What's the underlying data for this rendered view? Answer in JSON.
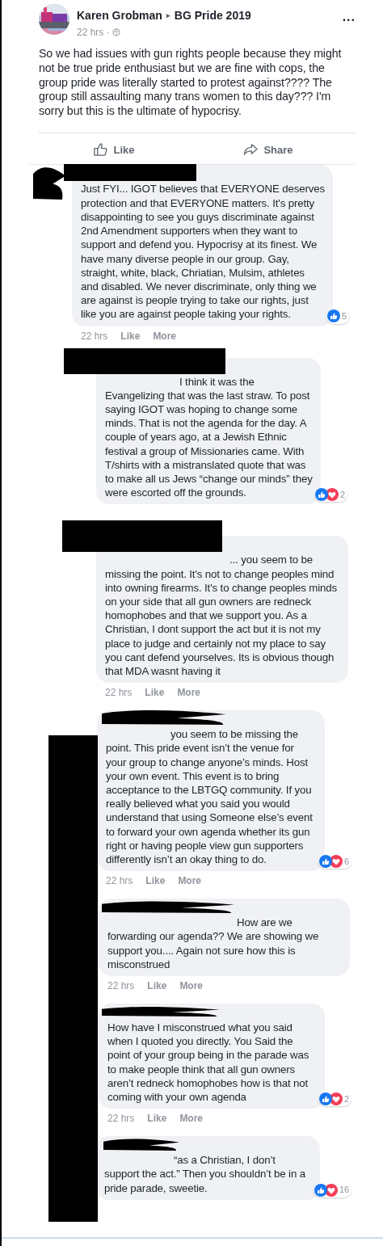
{
  "post": {
    "author": "Karen Grobman",
    "separator": "▸",
    "group": "BG Pride 2019",
    "time": "22 hrs ·",
    "more": "...",
    "text": "So we had issues with gun rights people because they might not be true pride enthusiast but we are fine with cops, the group pride was literally started to protest against???? The group still assaulting many trans women to this day??? I'm sorry but this is the ultimate of hypocrisy.",
    "actions": [
      {
        "kind": "like",
        "label": "Like"
      },
      {
        "kind": "share",
        "label": "Share"
      }
    ]
  },
  "side_redaction": true,
  "comments": [
    {
      "redaction": {
        "kind": "block"
      },
      "text": "Just FYI... IGOT believes that EVERYONE deserves protection and that EVERYONE matters. It's pretty disappointing to see you guys discriminate against 2nd Amendment supporters when they want to support and defend you. Hypocrisy at its finest. We have many diverse people in our group. Gay, straight, white, black, Chriatian, Mulsim, athletes and disabled. We never discriminate, only thing we are against is people trying to take our rights, just like you are against people taking your rights.",
      "reactions": [
        {
          "kind": "like"
        }
      ],
      "reaction_count": "5",
      "actions": [
        "22 hrs",
        "Like",
        "More"
      ]
    },
    {
      "redaction": {
        "kind": "block"
      },
      "text": "I think it was the Evangelizing that was the last straw. To post saying IGOT was hoping to change some minds. That is not the agenda for the day. A couple of years ago, at a Jewish Ethnic festival a group of Missionaries came. With T/shirts with a mistranslated quote that was to make all us Jews “change our minds” they were escorted off the grounds.",
      "reactions": [
        {
          "kind": "like"
        },
        {
          "kind": "love"
        }
      ],
      "reaction_count": "2"
    },
    {
      "redaction": {
        "kind": "block"
      },
      "text": "... you seem to be missing the point. It's not to change peoples mind into owning firearms. It's to change peoples minds on your side that all gun owners are redneck homophobes and that we support you. As a Christian, I dont support the act but it is not my place to judge and certainly not my place to say you cant defend yourselves. Its is obvious though that MDA wasnt having it",
      "actions": [
        "22 hrs",
        "Like",
        "More"
      ]
    },
    {
      "redaction": {
        "kind": "scribble"
      },
      "text": "you seem to be missing the point. This pride event isn’t the venue for your group to change anyone’s minds. Host your own event. This event is to bring acceptance to the LBTGQ community. If you really believed what you said you would understand that using Someone else’s event to forward your own agenda whether its gun right or having people view gun supporters differently isn’t an okay thing to do.",
      "reactions": [
        {
          "kind": "like"
        },
        {
          "kind": "love"
        }
      ],
      "reaction_count": "6",
      "actions": [
        "22 hrs",
        "Like",
        "More"
      ]
    },
    {
      "redaction": {
        "kind": "scribble"
      },
      "text": "How are we forwarding our agenda?? We are showing we support you.... Again not sure how this is misconstrued",
      "actions": [
        "22 hrs",
        "Like",
        "More"
      ]
    },
    {
      "redaction": {
        "kind": "scribble"
      },
      "text": "How have I misconstrued what you said when I quoted you directly. You Said the point of your group being in the parade was to make people think that all gun owners aren’t redneck homophobes how is that not coming with your own agenda",
      "reactions": [
        {
          "kind": "like"
        },
        {
          "kind": "love"
        }
      ],
      "reaction_count": "2",
      "actions": [
        "22 hrs",
        "Like",
        "More"
      ]
    },
    {
      "redaction": {
        "kind": "scribble"
      },
      "text": "“as a Christian, I don’t support the act.” Then you shouldn’t be in a pride parade, sweetie.",
      "reactions": [
        {
          "kind": "like"
        },
        {
          "kind": "love"
        }
      ],
      "reaction_count": "16"
    }
  ]
}
